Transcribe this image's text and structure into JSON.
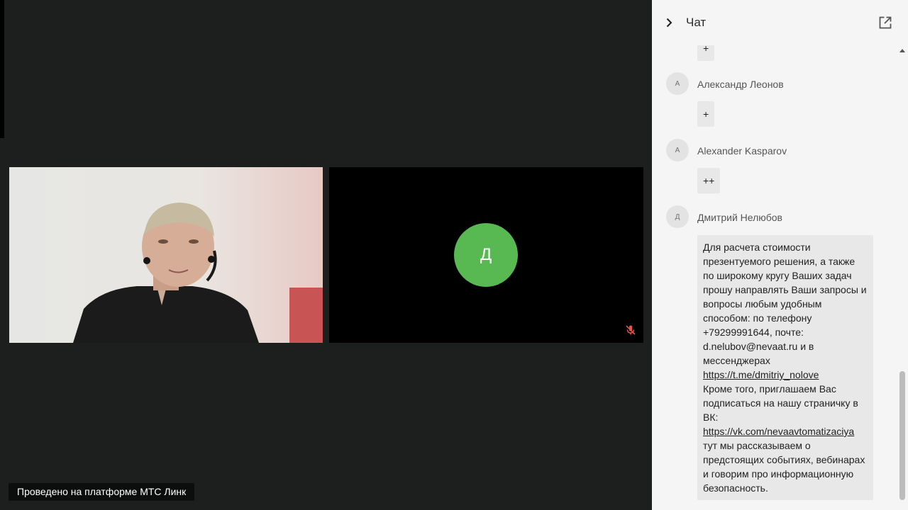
{
  "branding": {
    "text": "Проведено на платформе МТС Линк"
  },
  "tiles": [
    {
      "type": "camera",
      "description": "participant-video"
    },
    {
      "type": "avatar",
      "initial": "Д",
      "avatar_color": "#58b952",
      "muted": true
    }
  ],
  "chat": {
    "title": "Чат",
    "icons": {
      "collapse": "chevron-right-icon",
      "popout": "external-link-icon"
    },
    "messages": [
      {
        "author": "",
        "initial": "",
        "text": "+"
      },
      {
        "author": "Александр Леонов",
        "initial": "А",
        "text": "+"
      },
      {
        "author": "Alexander Kasparov",
        "initial": "A",
        "text": "++"
      },
      {
        "author": "Дмитрий Нелюбов",
        "initial": "Д",
        "text_before_link1": "Для расчета стоимости презентуемого решения, а также по широкому кругу Ваших задач прошу направлять Ваши запросы и вопросы любым удобным способом: по телефону +79299991644, почте: d.nelubov@nevaat.ru и в мессенджерах",
        "link1": "https://t.me/dmitriy_nolove",
        "text_between": "Кроме того, приглашаем Вас подписаться на нашу страничку в ВК:",
        "link2": "https://vk.com/nevaavtomatizaciya",
        "text_after": "тут мы рассказываем о предстоящих событиях, вебинарах и говорим про информационную безопасность."
      }
    ]
  }
}
